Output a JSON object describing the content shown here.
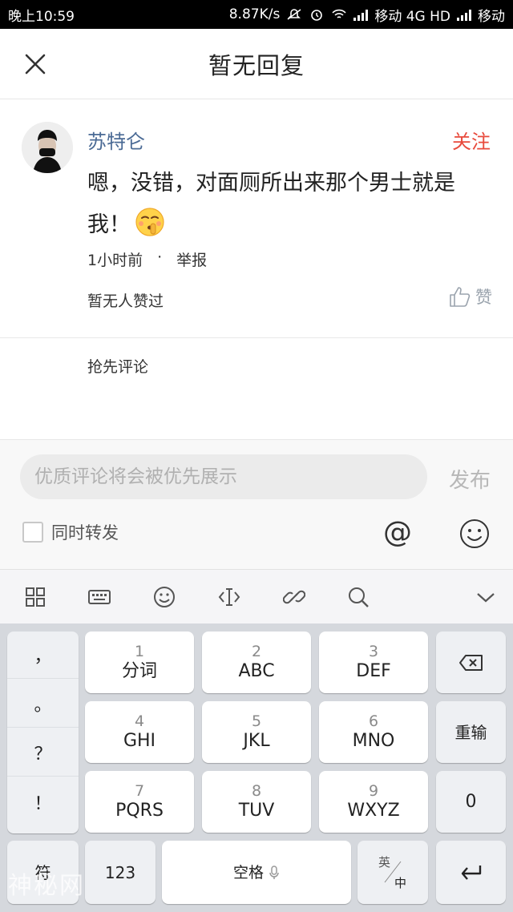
{
  "status_bar": {
    "time": "晚上10:59",
    "network_speed": "8.87K/s",
    "carrier1": "移动 4G HD",
    "carrier2": "移动"
  },
  "header": {
    "title": "暂无回复"
  },
  "comment": {
    "username": "苏特仑",
    "follow_label": "关注",
    "text": "嗯，没错，对面厕所出来那个男士就是我！",
    "time": "1小时前",
    "separator": "·",
    "report_label": "举报",
    "likes_text": "暂无人赞过",
    "like_label": "赞"
  },
  "first_comment_prompt": "抢先评论",
  "input": {
    "placeholder": "优质评论将会被优先展示",
    "publish_label": "发布",
    "repost_label": "同时转发",
    "at_symbol": "@"
  },
  "keyboard": {
    "punctuation": [
      "，",
      "。",
      "？",
      "！"
    ],
    "keys": [
      {
        "num": "1",
        "label": "分词"
      },
      {
        "num": "2",
        "label": "ABC"
      },
      {
        "num": "3",
        "label": "DEF"
      },
      {
        "num": "4",
        "label": "GHI"
      },
      {
        "num": "5",
        "label": "JKL"
      },
      {
        "num": "6",
        "label": "MNO"
      },
      {
        "num": "7",
        "label": "PQRS"
      },
      {
        "num": "8",
        "label": "TUV"
      },
      {
        "num": "9",
        "label": "WXYZ"
      }
    ],
    "reset_label": "重输",
    "zero_label": "0",
    "symbol_label": "符",
    "num_label": "123",
    "space_label": "空格",
    "lang_top": "英",
    "lang_bottom": "中"
  },
  "watermark": "神秘网",
  "colors": {
    "accent_red": "#e84a3c",
    "username_blue": "#4a6a95",
    "keyboard_bg": "#d5d8dd"
  }
}
